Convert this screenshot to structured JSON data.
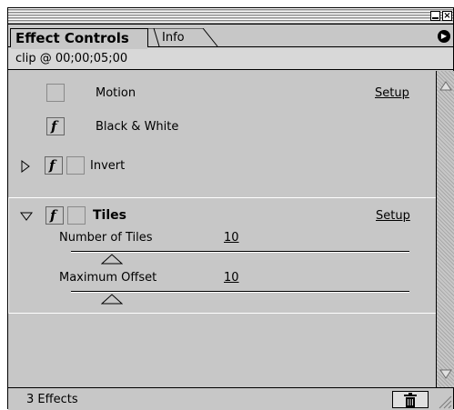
{
  "panel": {
    "tabs": [
      {
        "label": "Effect Controls",
        "active": true
      },
      {
        "label": "Info",
        "active": false
      }
    ],
    "clip_label": "clip @ 00;00;05;00",
    "effects": [
      {
        "name": "Motion",
        "action": "Setup",
        "fx": false
      },
      {
        "name": "Black & White",
        "fx": true
      },
      {
        "name": "Invert",
        "fx": true,
        "expanded": false
      },
      {
        "name": "Tiles",
        "action": "Setup",
        "fx": true,
        "expanded": true,
        "params": [
          {
            "label": "Number of Tiles",
            "value": "10",
            "level": 0.12
          },
          {
            "label": "Maximum Offset",
            "value": "10",
            "level": 0.12
          }
        ]
      }
    ],
    "fx_glyph": "f",
    "status": "3 Effects",
    "icons": {
      "menu": "panel-menu-icon",
      "trash": "trash-icon",
      "minimize": "minimize-icon",
      "close": "close-icon"
    }
  }
}
